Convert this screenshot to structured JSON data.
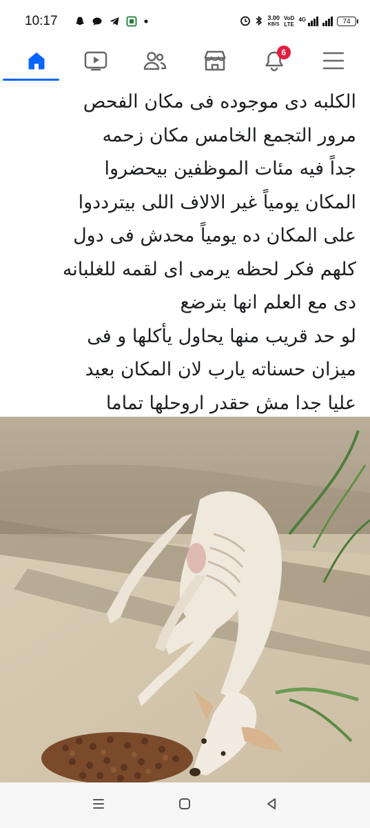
{
  "status_bar": {
    "time": "10:17",
    "net_speed_value": "3.00",
    "net_speed_unit": "KB/S",
    "volte_top": "VoD",
    "volte_bottom": "LTE",
    "signal_label": "4G",
    "battery": "74"
  },
  "fb_nav": {
    "items": [
      {
        "name": "home",
        "icon": "home-icon",
        "active": true
      },
      {
        "name": "video",
        "icon": "video-icon"
      },
      {
        "name": "friends",
        "icon": "friends-icon"
      },
      {
        "name": "marketplace",
        "icon": "marketplace-icon"
      },
      {
        "name": "notifications",
        "icon": "bell-icon",
        "badge": "6"
      },
      {
        "name": "menu",
        "icon": "hamburger-menu-icon"
      }
    ],
    "accent_color": "#0866ff",
    "badge_color": "#e41e3f"
  },
  "post": {
    "lines": [
      "الكلبه دى موجوده فى مكان الفحص",
      "مرور التجمع الخامس مكان زحمه",
      "جداً فيه مئات الموظفين بيحضروا",
      "المكان يومياً غير الالاف اللى بيترددوا",
      "على المكان ده يومياً محدش فى دول",
      "كلهم فكر لحظه يرمى اى لقمه للغلبانه",
      "دى مع العلم انها بترضع",
      "لو حد قريب منها يحاول يأكلها و فى",
      "ميزان حسناته يارب لان المكان بعيد",
      "عليا جدا مش حقدر اروحلها تماما"
    ]
  },
  "system_nav": {
    "items": [
      "recents-icon",
      "home-circle-icon",
      "back-icon"
    ]
  }
}
